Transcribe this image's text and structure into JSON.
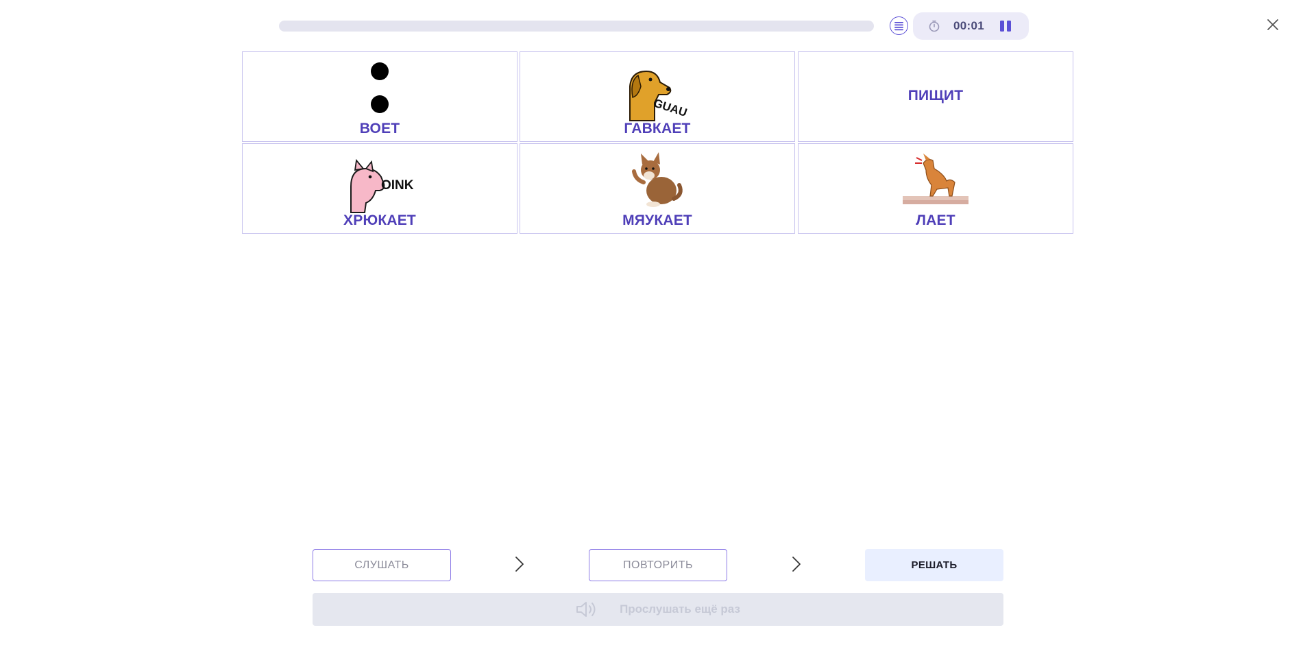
{
  "progress": {
    "fraction": 0.0
  },
  "timer": {
    "time": "00:01"
  },
  "cards": [
    {
      "label": "ВОЕТ",
      "image": "colon-symbol"
    },
    {
      "label": "ГАВКАЕТ",
      "image": "dog-guau",
      "image_text": "GUAU"
    },
    {
      "label": "ПИЩИТ",
      "image": "none"
    },
    {
      "label": "ХРЮКАЕТ",
      "image": "pig-oink",
      "image_text": "OINK"
    },
    {
      "label": "МЯУКАЕТ",
      "image": "cat"
    },
    {
      "label": "ЛАЕТ",
      "image": "barking-dog"
    }
  ],
  "controls": {
    "listen": "СЛУШАТЬ",
    "repeat": "ПОВТОРИТЬ",
    "solve": "РЕШАТЬ",
    "replay": "Прослушать ещё раз"
  },
  "icons": {
    "list": "list-icon",
    "clock": "stopwatch-icon",
    "pause": "pause-icon",
    "close": "close-icon",
    "arrow": "chevron-right-icon",
    "speaker": "speaker-icon"
  },
  "colors": {
    "accent": "#5b4fd6",
    "label": "#4f3fb8",
    "card_border": "#c6c1ee",
    "solve_bg": "#e9efff",
    "replay_bg": "#e5e7ef"
  }
}
